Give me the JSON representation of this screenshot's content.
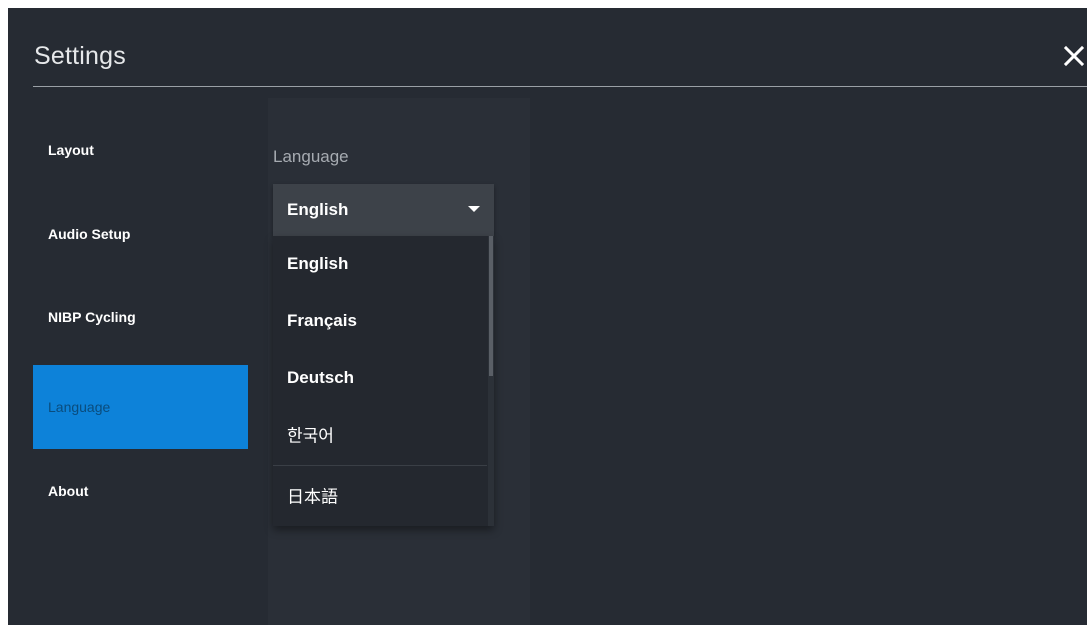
{
  "window": {
    "title": "Settings",
    "close_icon": "close-icon"
  },
  "sidebar": {
    "items": [
      {
        "label": "Layout",
        "active": false
      },
      {
        "label": "Audio Setup",
        "active": false
      },
      {
        "label": "NIBP Cycling",
        "active": false
      },
      {
        "label": "Language",
        "active": true
      },
      {
        "label": "About",
        "active": false
      }
    ]
  },
  "language_section": {
    "label": "Language",
    "selected": "English",
    "options": [
      "English",
      "Français",
      "Deutsch",
      "한국어",
      "日本語"
    ]
  },
  "colors": {
    "background": "#262b33",
    "accent": "#0d82d9",
    "dropdown": "#24282f",
    "select": "#3d4249"
  }
}
